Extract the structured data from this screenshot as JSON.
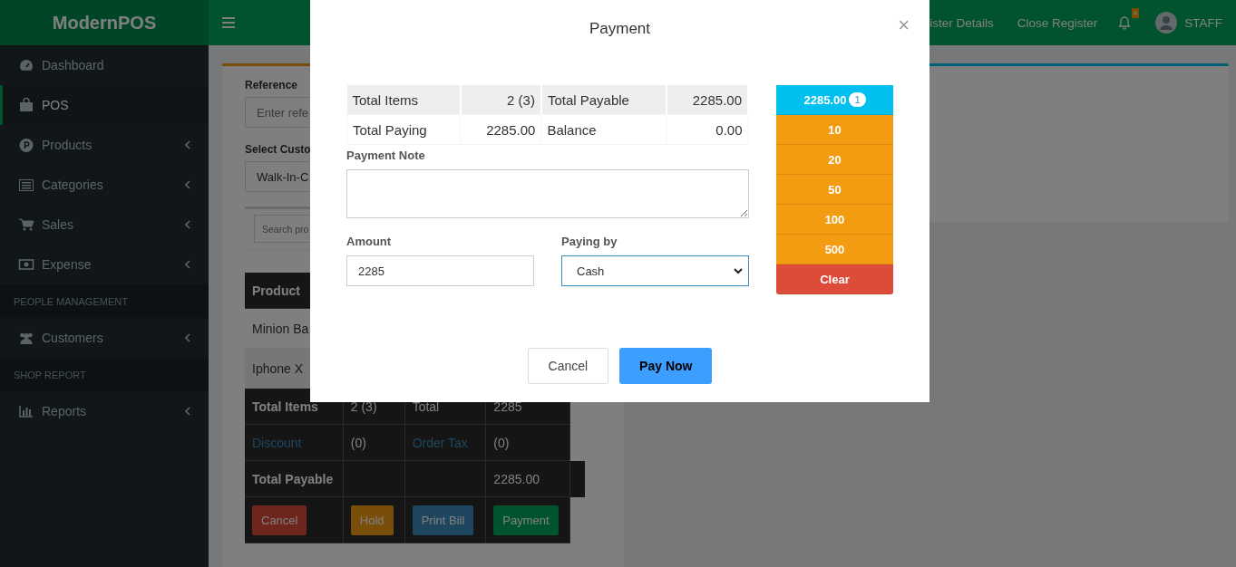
{
  "app": {
    "brand": "ModernPOS"
  },
  "navbar": {
    "links": [
      {
        "label": "ister Details"
      },
      {
        "label": "Close Register"
      }
    ],
    "notifications": {
      "count": "4"
    },
    "user": {
      "name": "STAFF"
    }
  },
  "sidebar": {
    "items": [
      {
        "kind": "link",
        "label": "Dashboard",
        "selected": false,
        "expandable": false
      },
      {
        "kind": "link",
        "label": "POS",
        "selected": true,
        "expandable": false
      },
      {
        "kind": "link",
        "label": "Products",
        "selected": false,
        "expandable": true
      },
      {
        "kind": "link",
        "label": "Categories",
        "selected": false,
        "expandable": true
      },
      {
        "kind": "link",
        "label": "Sales",
        "selected": false,
        "expandable": true
      },
      {
        "kind": "link",
        "label": "Expense",
        "selected": false,
        "expandable": true
      },
      {
        "kind": "header",
        "label": "PEOPLE MANAGEMENT"
      },
      {
        "kind": "link",
        "label": "Customers",
        "selected": false,
        "expandable": true
      },
      {
        "kind": "header",
        "label": "SHOP REPORT"
      },
      {
        "kind": "link",
        "label": "Reports",
        "selected": false,
        "expandable": true
      }
    ]
  },
  "pos_form": {
    "reference": {
      "label": "Reference",
      "placeholder": "Enter refe"
    },
    "customer": {
      "label": "Select Custo",
      "value": "Walk-In-C"
    },
    "search": {
      "placeholder": "Search pro"
    }
  },
  "cart_table": {
    "header": "Product",
    "items": [
      "Minion Ba",
      "Iphone X"
    ],
    "totals": [
      {
        "kind": "plain",
        "cells": [
          "Total Items",
          "2 (3)",
          "Total",
          "2285"
        ]
      },
      {
        "kind": "links",
        "cells": [
          "Discount",
          "(0)",
          "Order Tax",
          "(0)"
        ]
      },
      {
        "kind": "payable",
        "cells": [
          "Total Payable",
          "",
          "",
          "2285.00"
        ]
      }
    ],
    "buttons": [
      {
        "label": "Cancel",
        "kind": "danger"
      },
      {
        "label": "Hold",
        "kind": "warning"
      },
      {
        "label": "Print Bill",
        "kind": "primary"
      },
      {
        "label": "Payment",
        "kind": "success"
      }
    ]
  },
  "modal": {
    "title": "Payment",
    "close": "×",
    "summary": [
      [
        "Total Items",
        "2 (3)",
        "Total Payable",
        "2285.00"
      ],
      [
        "Total Paying",
        "2285.00",
        "Balance",
        "0.00"
      ]
    ],
    "note": {
      "label": "Payment Note"
    },
    "amount": {
      "label": "Amount",
      "value": "2285"
    },
    "paying_by": {
      "label": "Paying by",
      "value": "Cash"
    },
    "quick_cash": [
      {
        "kind": "exact",
        "label": "2285.00",
        "count": "1"
      },
      {
        "kind": "note",
        "label": "10"
      },
      {
        "kind": "note",
        "label": "20"
      },
      {
        "kind": "note",
        "label": "50"
      },
      {
        "kind": "note",
        "label": "100"
      },
      {
        "kind": "note",
        "label": "500"
      },
      {
        "kind": "clear",
        "label": "Clear"
      }
    ],
    "buttons": [
      {
        "label": "Cancel",
        "kind": "default"
      },
      {
        "label": "Pay Now",
        "kind": "primary"
      }
    ]
  }
}
